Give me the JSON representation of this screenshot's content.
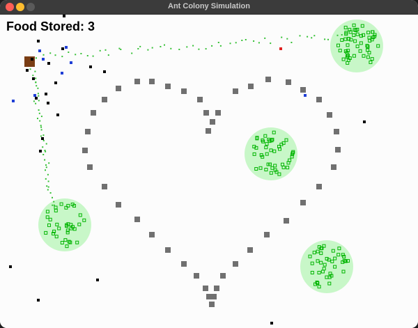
{
  "window": {
    "title": "Ant Colony Simulation"
  },
  "hud": {
    "food_stored": "Food Stored: 3"
  },
  "colors": {
    "background": "#fcfcfc",
    "food_zone": "#c8f7c8",
    "food": "#00b400",
    "obstacle": "#707070",
    "nest": "#7a3d14",
    "ant": "#000000",
    "scout": "#1f3fd6",
    "pheromone": "#34c034",
    "alert": "#e02020"
  }
}
